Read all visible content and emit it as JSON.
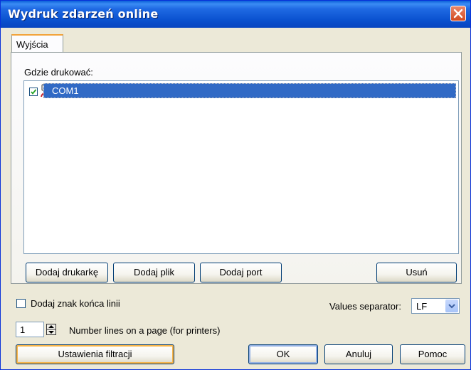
{
  "window": {
    "title": "Wydruk zdarzeń online"
  },
  "tabs": [
    {
      "label": "Wyjścia"
    }
  ],
  "outputs": {
    "label": "Gdzie drukować:",
    "items": [
      {
        "label": "COM1",
        "checked": true,
        "icon": "serial-port-icon",
        "selected": true
      }
    ]
  },
  "list_buttons": {
    "add_printer": "Dodaj drukarkę",
    "add_file": "Dodaj plik",
    "add_port": "Dodaj port",
    "remove": "Usuń"
  },
  "options": {
    "add_eol_label": "Dodaj znak końca linii",
    "add_eol_checked": false,
    "separator_label": "Values separator:",
    "separator_value": "LF",
    "lines_value": "1",
    "lines_label": "Number lines on a page (for printers)"
  },
  "footer": {
    "filter_settings": "Ustawienia filtracji",
    "ok": "OK",
    "cancel": "Anuluj",
    "help": "Pomoc"
  },
  "colors": {
    "selection": "#316ac5",
    "titlebar": "#0b52d0",
    "dialog_bg": "#ece9d8"
  }
}
